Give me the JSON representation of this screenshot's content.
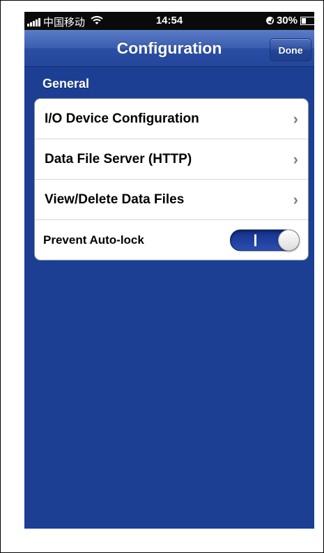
{
  "status_bar": {
    "carrier": "中国移动",
    "time": "14:54",
    "battery": "30%",
    "battery_level": 0.3
  },
  "navbar": {
    "title": "Configuration",
    "done_label": "Done"
  },
  "section": {
    "header": "General"
  },
  "rows": [
    {
      "label": "I/O Device Configuration"
    },
    {
      "label": "Data File Server (HTTP)"
    },
    {
      "label": "View/Delete Data Files"
    },
    {
      "label": "Prevent Auto-lock",
      "toggle_on": true
    }
  ],
  "colors": {
    "background": "#1c3f94",
    "navbar": "#2a4ea3",
    "toggle_on": "#2c4fb0"
  },
  "icons": {
    "chevron": "chevron-right-icon",
    "wifi": "wifi-icon",
    "signal": "signal-strength-icon",
    "battery": "battery-icon",
    "rotation_lock": "rotation-lock-icon"
  }
}
